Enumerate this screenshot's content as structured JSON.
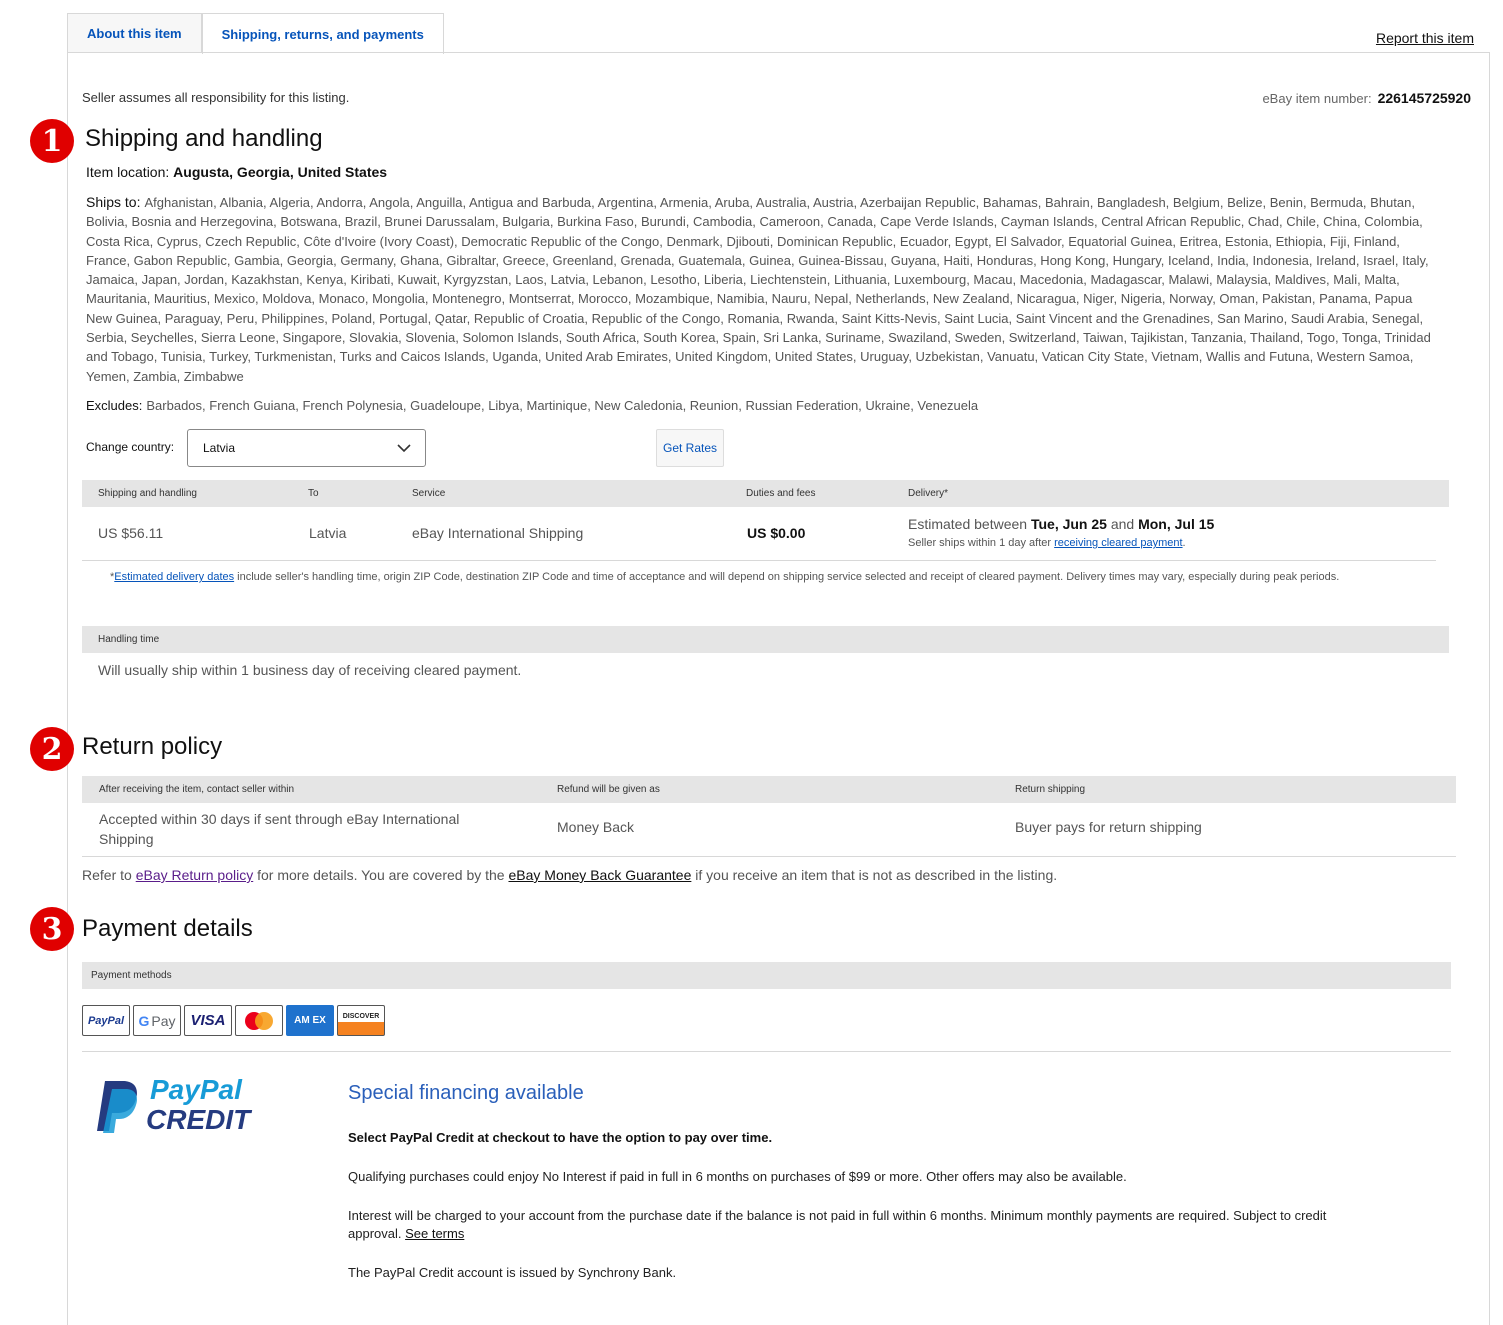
{
  "tabs": [
    {
      "label": "About this item"
    },
    {
      "label": "Shipping, returns, and payments"
    }
  ],
  "report_link": "Report this item",
  "seller_responsibility": "Seller assumes all responsibility for this listing.",
  "item_number": {
    "label": "eBay item number:",
    "value": "226145725920"
  },
  "annotations": {
    "one": "1",
    "two": "2",
    "three": "3"
  },
  "shipping": {
    "title": "Shipping and handling",
    "item_location_label": "Item location:",
    "item_location_value": "Augusta, Georgia, United States",
    "ships_to_label": "Ships to:",
    "ships_to_list": "Afghanistan, Albania, Algeria, Andorra, Angola, Anguilla, Antigua and Barbuda, Argentina, Armenia, Aruba, Australia, Austria, Azerbaijan Republic, Bahamas, Bahrain, Bangladesh, Belgium, Belize, Benin, Bermuda, Bhutan, Bolivia, Bosnia and Herzegovina, Botswana, Brazil, Brunei Darussalam, Bulgaria, Burkina Faso, Burundi, Cambodia, Cameroon, Canada, Cape Verde Islands, Cayman Islands, Central African Republic, Chad, Chile, China, Colombia, Costa Rica, Cyprus, Czech Republic, Côte d'Ivoire (Ivory Coast), Democratic Republic of the Congo, Denmark, Djibouti, Dominican Republic, Ecuador, Egypt, El Salvador, Equatorial Guinea, Eritrea, Estonia, Ethiopia, Fiji, Finland, France, Gabon Republic, Gambia, Georgia, Germany, Ghana, Gibraltar, Greece, Greenland, Grenada, Guatemala, Guinea, Guinea-Bissau, Guyana, Haiti, Honduras, Hong Kong, Hungary, Iceland, India, Indonesia, Ireland, Israel, Italy, Jamaica, Japan, Jordan, Kazakhstan, Kenya, Kiribati, Kuwait, Kyrgyzstan, Laos, Latvia, Lebanon, Lesotho, Liberia, Liechtenstein, Lithuania, Luxembourg, Macau, Macedonia, Madagascar, Malawi, Malaysia, Maldives, Mali, Malta, Mauritania, Mauritius, Mexico, Moldova, Monaco, Mongolia, Montenegro, Montserrat, Morocco, Mozambique, Namibia, Nauru, Nepal, Netherlands, New Zealand, Nicaragua, Niger, Nigeria, Norway, Oman, Pakistan, Panama, Papua New Guinea, Paraguay, Peru, Philippines, Poland, Portugal, Qatar, Republic of Croatia, Republic of the Congo, Romania, Rwanda, Saint Kitts-Nevis, Saint Lucia, Saint Vincent and the Grenadines, San Marino, Saudi Arabia, Senegal, Serbia, Seychelles, Sierra Leone, Singapore, Slovakia, Slovenia, Solomon Islands, South Africa, South Korea, Spain, Sri Lanka, Suriname, Swaziland, Sweden, Switzerland, Taiwan, Tajikistan, Tanzania, Thailand, Togo, Tonga, Trinidad and Tobago, Tunisia, Turkey, Turkmenistan, Turks and Caicos Islands, Uganda, United Arab Emirates, United Kingdom, United States, Uruguay, Uzbekistan, Vanuatu, Vatican City State, Vietnam, Wallis and Futuna, Western Samoa, Yemen, Zambia, Zimbabwe",
    "excludes_label": "Excludes:",
    "excludes_list": "Barbados, French Guiana, French Polynesia, Guadeloupe, Libya, Martinique, New Caledonia, Reunion, Russian Federation, Ukraine, Venezuela",
    "change_country_label": "Change country:",
    "selected_country": "Latvia",
    "get_rates_label": "Get Rates",
    "table_headers": {
      "shipping": "Shipping and handling",
      "to": "To",
      "service": "Service",
      "duties": "Duties and fees",
      "delivery": "Delivery*"
    },
    "row": {
      "cost": "US $56.11",
      "to": "Latvia",
      "service": "eBay International Shipping",
      "duties": "US $0.00",
      "est_prefix": "Estimated between ",
      "est_start": "Tue, Jun 25",
      "est_and": " and ",
      "est_end": "Mon, Jul 15",
      "seller_ships_prefix": "Seller ships within 1 day after ",
      "seller_ships_link": "receiving cleared payment",
      "seller_ships_suffix": "."
    },
    "footnote_star": "*",
    "footnote_link": "Estimated delivery dates",
    "footnote_text": " include seller's handling time, origin ZIP Code, destination ZIP Code and time of acceptance and will depend on shipping service selected and receipt of cleared payment. Delivery times may vary, especially during peak periods.",
    "handling_header": "Handling time",
    "handling_text": "Will usually ship within 1 business day of receiving cleared payment."
  },
  "returns": {
    "title": "Return policy",
    "headers": {
      "contact": "After receiving the item, contact seller within",
      "refund": "Refund will be given as",
      "shipping": "Return shipping"
    },
    "row": {
      "contact": "Accepted within 30 days if sent through eBay International Shipping",
      "refund": "Money Back",
      "shipping": "Buyer pays for return shipping"
    },
    "refer_prefix": "Refer to ",
    "refer_link": "eBay Return policy",
    "refer_middle": " for more details. You are covered by the ",
    "refer_link2": "eBay Money Back Guarantee",
    "refer_suffix": " if you receive an item that is not as described in the listing."
  },
  "payment": {
    "title": "Payment details",
    "methods_header": "Payment methods",
    "methods": [
      {
        "name": "paypal-icon",
        "label": "PayPal"
      },
      {
        "name": "google-pay-icon",
        "label_g": "G",
        "label": "Pay"
      },
      {
        "name": "visa-icon",
        "label": "VISA"
      },
      {
        "name": "mastercard-icon",
        "label": ""
      },
      {
        "name": "amex-icon",
        "label": "AM EX"
      },
      {
        "name": "discover-icon",
        "label": "DISCOVER"
      }
    ],
    "paypal_credit_logo": {
      "line1": "PayPal",
      "line2": "CREDIT"
    },
    "financing_title": "Special financing available",
    "financing_bold": "Select PayPal Credit at checkout to have the option to pay over time.",
    "financing_p1": "Qualifying purchases could enjoy No Interest if paid in full in 6 months on purchases of $99 or more. Other offers may also be available.",
    "financing_p2": "Interest will be charged to your account from the purchase date if the balance is not paid in full within 6 months. Minimum monthly payments are required. Subject to credit approval. ",
    "see_terms": "See terms",
    "financing_p3": "The PayPal Credit account is issued by Synchrony Bank."
  },
  "colors": {
    "link": "#0654ba",
    "badge": "#e00000",
    "header_bg": "#e5e5e5",
    "financing_title": "#2a5fba"
  }
}
